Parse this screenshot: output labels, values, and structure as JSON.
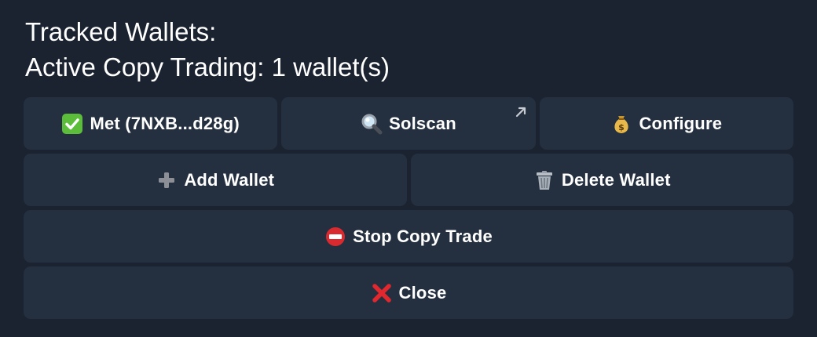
{
  "message": {
    "line1": "Tracked Wallets:",
    "line2": "Active Copy Trading: 1 wallet(s)"
  },
  "buttons": {
    "wallet": {
      "label": "Met (7NXB...d28g)",
      "icon": "check-mark-icon"
    },
    "solscan": {
      "label": "Solscan",
      "icon": "magnifier-icon",
      "link_icon": "external-link-arrow-icon"
    },
    "configure": {
      "label": "Configure",
      "icon": "money-bag-icon"
    },
    "add_wallet": {
      "label": "Add Wallet",
      "icon": "plus-icon"
    },
    "delete_wallet": {
      "label": "Delete Wallet",
      "icon": "trash-can-icon"
    },
    "stop_copy_trade": {
      "label": "Stop Copy Trade",
      "icon": "no-entry-icon"
    },
    "close": {
      "label": "Close",
      "icon": "cross-mark-icon"
    }
  },
  "colors": {
    "background": "#1b2330",
    "button": "#243040",
    "text": "#ffffff",
    "check_green": "#5bbd3a",
    "cross_red": "#e0282e"
  }
}
